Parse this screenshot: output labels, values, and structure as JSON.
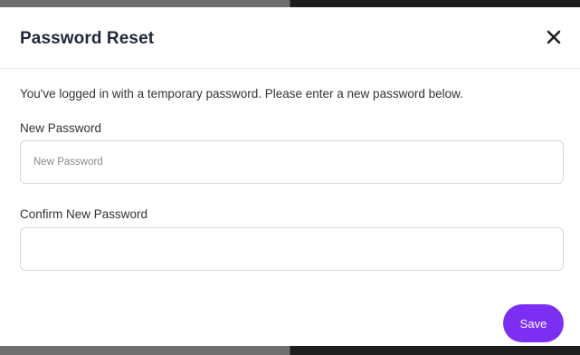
{
  "dialog": {
    "title": "Password Reset",
    "close_icon": "close-icon",
    "message": "You've logged in with a temporary password. Please enter a new password below.",
    "fields": {
      "new_password": {
        "label": "New Password",
        "value": "",
        "placeholder": "New Password"
      },
      "confirm_password": {
        "label": "Confirm New Password",
        "value": "",
        "placeholder": ""
      }
    },
    "save_label": "Save"
  },
  "colors": {
    "accent": "#7c2ff2",
    "title": "#1f2937",
    "text": "#333333",
    "border": "#d9d9d9"
  }
}
